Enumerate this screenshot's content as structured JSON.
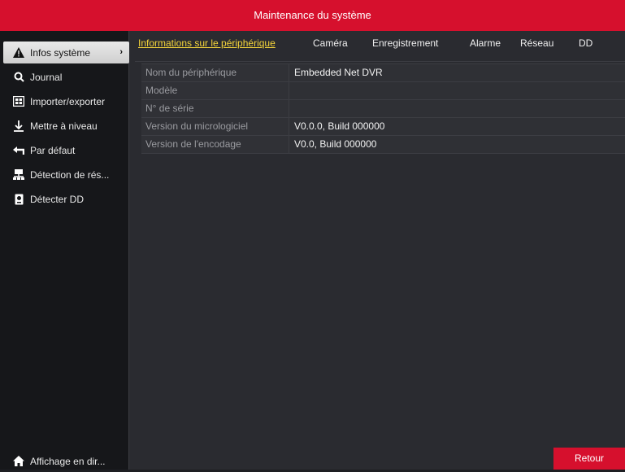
{
  "window": {
    "title": "Maintenance du système"
  },
  "sidebar": {
    "items": [
      {
        "label": "Infos système",
        "icon": "warning-icon",
        "active": true
      },
      {
        "label": "Journal",
        "icon": "search-icon"
      },
      {
        "label": "Importer/exporter",
        "icon": "import-export-icon"
      },
      {
        "label": "Mettre à niveau",
        "icon": "download-icon"
      },
      {
        "label": "Par défaut",
        "icon": "restore-default-icon"
      },
      {
        "label": "Détection de rés...",
        "icon": "network-icon"
      },
      {
        "label": "Détecter DD",
        "icon": "disk-icon"
      }
    ],
    "footer": {
      "label": "Affichage en dir...",
      "icon": "home-icon"
    }
  },
  "tabs": [
    {
      "label": "Informations sur le périphérique",
      "active": true
    },
    {
      "label": "Caméra"
    },
    {
      "label": "Enregistrement"
    },
    {
      "label": "Alarme"
    },
    {
      "label": "Réseau"
    },
    {
      "label": "DD"
    }
  ],
  "device_info": {
    "rows": [
      {
        "label": "Nom du périphérique",
        "value": "Embedded Net DVR"
      },
      {
        "label": "Modèle",
        "value": ""
      },
      {
        "label": "N° de série",
        "value": ""
      },
      {
        "label": "Version du micrologiciel",
        "value": "V0.0.0, Build 000000"
      },
      {
        "label": "Version de l'encodage",
        "value": "V0.0, Build 000000"
      }
    ]
  },
  "buttons": {
    "back": "Retour"
  },
  "colors": {
    "accent": "#d6102d",
    "active_tab": "#f4d43a",
    "sidebar_bg": "#16171a",
    "content_bg": "#2a2b30"
  }
}
